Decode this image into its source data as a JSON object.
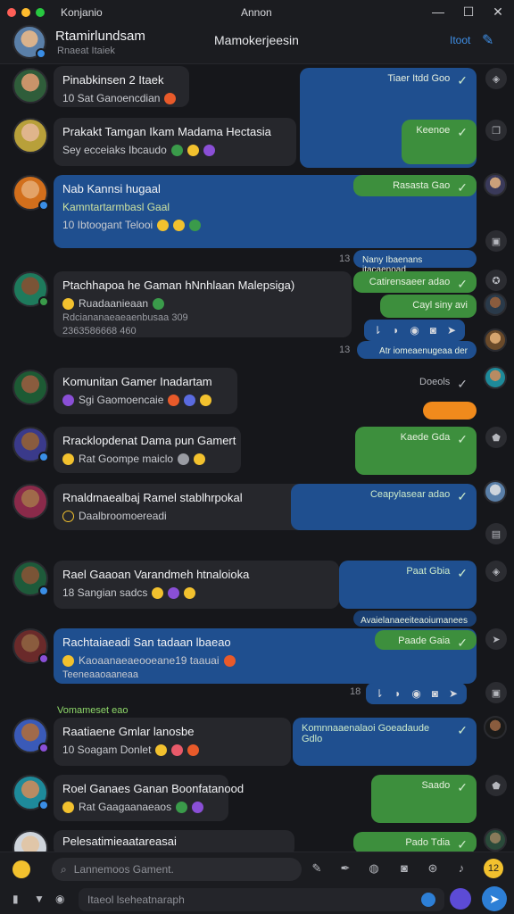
{
  "window": {
    "title_left": "Konjanio",
    "title_center": "Annon",
    "controls": {
      "minimize": "—",
      "maximize": "☐",
      "close": "✕"
    },
    "dot_colors": [
      "#ff5f57",
      "#febc2e",
      "#28c840"
    ]
  },
  "header": {
    "name": "Rtamirlundsam",
    "subtitle": "Rnaeat Itaiek",
    "center": "Mamokerjeesin",
    "right_link": "Itoot",
    "compose_icon": "compose-icon"
  },
  "messages": [
    {
      "title": "Pinabkinsen 2 Itaek",
      "line": "10 Sat Ganoencdian"
    },
    {
      "title": "Prakakt Tamgan Ikam Madama Hectasia",
      "line": "Sey ecceiaks  Ibcaudo"
    },
    {
      "title": "Nab Kannsi hugaal",
      "sub": "Kamntartarmbasl Gaal",
      "line": "10  Ibtoogant   Telooi"
    },
    {
      "title": "Ptachhapoa he Gaman hNnhlaan Malepsiga)",
      "line": "Ruadaanieaan",
      "line2": "Rdciananaeaeaenbusaa 309",
      "line3": "2363586668 460"
    },
    {
      "title": "Komunitan Gamer Inadartam",
      "line": "Sgi Gaomoencaie"
    },
    {
      "title": "Rracklopdenat Dama pun Gamert",
      "line": "Rat Goompe maiclo"
    },
    {
      "title": "Rnaldmaealbaj Ramel stablhrpokal",
      "line": "Daalbroomoereadi"
    },
    {
      "title": "Rael Gaaoan Varandmeh htnaloioka",
      "line": "18  Sangian sadcs"
    },
    {
      "title": "Rachtaiaeadi San tadaan lbaeao",
      "line": "Kaoaanaeaeooeane19  taauai",
      "line2": "Teeneaaoaaneaa"
    },
    {
      "title": "Raatiaene Gmlar lanosbe",
      "line": "10  Soagam  Donlet"
    },
    {
      "title": "Roel Ganaes Ganan Boonfatanood",
      "line": "Rat Gaagaanaeaos"
    },
    {
      "title": "Pelesatimieaatareasai"
    }
  ],
  "outgoing": [
    {
      "text": "Tiaer Itdd Goo"
    },
    {
      "text": "Keenoe"
    },
    {
      "text": "Rasasta Gao"
    },
    {
      "text": "Nany Ibaenans itacaenoad"
    },
    {
      "text": "Catirensaeer adao"
    },
    {
      "text": "Cayl siny  avi"
    },
    {
      "text": "Atr iomeaenugeaa der"
    },
    {
      "text": "Doeols"
    },
    {
      "text": "Kaede Gda"
    },
    {
      "text": "Ceapylasear adao"
    },
    {
      "text": "Paat Gbia"
    },
    {
      "text": "Avaielanaeeiteaoiumanees"
    },
    {
      "text": "Paade Gaia"
    },
    {
      "text": "Komnnaaenalaoi Goeadaude Gdlo"
    },
    {
      "text": "Saado"
    },
    {
      "text": "Pado Tdia"
    }
  ],
  "timestamps": [
    "13",
    "13",
    "18"
  ],
  "section_label": "Vomameset eao",
  "composer": {
    "search_placeholder": "Lannemoos Gament.",
    "input_placeholder": "Itaeol lseheatnaraph",
    "badge": "12",
    "send_icon": "send-icon"
  }
}
